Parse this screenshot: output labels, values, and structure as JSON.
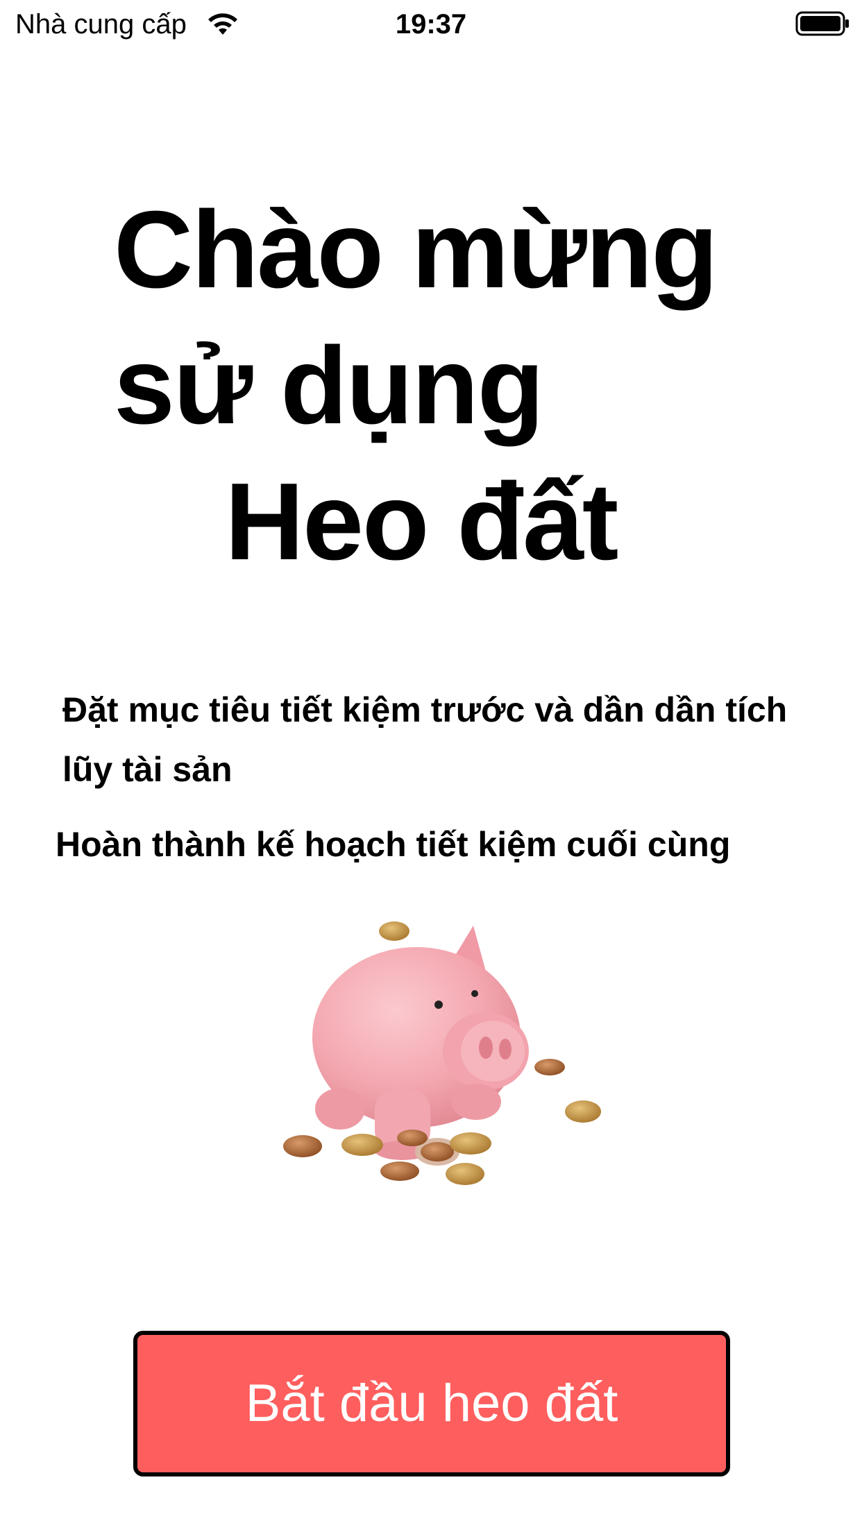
{
  "status_bar": {
    "carrier": "Nhà cung cấp",
    "time": "19:37",
    "wifi_icon": "wifi-icon",
    "battery_icon": "battery-full-icon"
  },
  "welcome": {
    "title_lines": [
      "Chào mừng",
      "sử dụng",
      "Heo đất"
    ],
    "description_1": "Đặt mục tiêu tiết kiệm trước và dần dần tích lũy tài sản",
    "description_2": "Hoàn thành kế hoạch tiết kiệm cuối cùng",
    "illustration_icon": "piggy-bank-with-coins-icon"
  },
  "start_button": {
    "label": "Bắt đầu heo đất",
    "background_color": "#ff5e5e",
    "text_color": "#ffffff"
  }
}
